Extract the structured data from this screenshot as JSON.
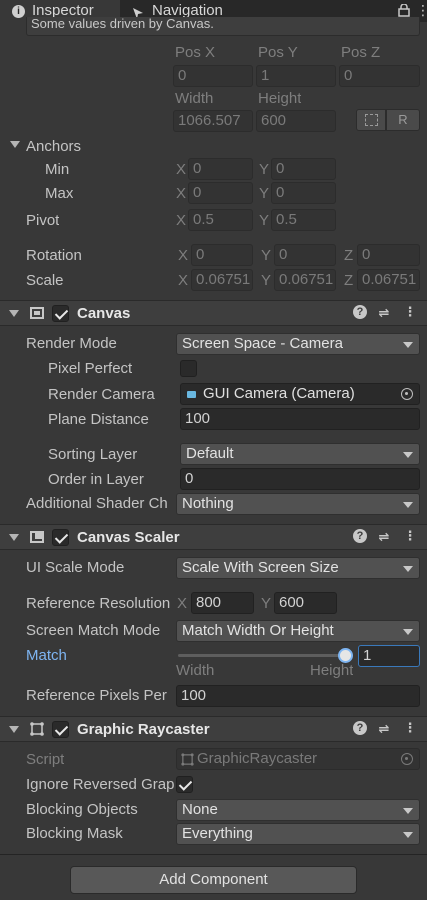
{
  "tabs": {
    "inspector": "Inspector",
    "navigation": "Navigation"
  },
  "rect_transform": {
    "info_text": "Some values driven by Canvas.",
    "pos_x_label": "Pos X",
    "pos_y_label": "Pos Y",
    "pos_z_label": "Pos Z",
    "pos_x": "0",
    "pos_y": "1",
    "pos_z": "0",
    "width_label": "Width",
    "height_label": "Height",
    "width": "1066.507",
    "height": "600",
    "raw_btn": "R",
    "anchors_label": "Anchors",
    "min_label": "Min",
    "max_label": "Max",
    "x": "X",
    "y": "Y",
    "z": "Z",
    "min_x": "0",
    "min_y": "0",
    "max_x": "0",
    "max_y": "0",
    "pivot_label": "Pivot",
    "pivot_x": "0.5",
    "pivot_y": "0.5",
    "rotation_label": "Rotation",
    "rot_x": "0",
    "rot_y": "0",
    "rot_z": "0",
    "scale_label": "Scale",
    "scale_x": "0.06751",
    "scale_y": "0.06751",
    "scale_z": "0.06751"
  },
  "canvas": {
    "title": "Canvas",
    "render_mode_label": "Render Mode",
    "render_mode": "Screen Space - Camera",
    "pixel_perfect_label": "Pixel Perfect",
    "render_camera_label": "Render Camera",
    "render_camera": "GUI Camera (Camera)",
    "plane_distance_label": "Plane Distance",
    "plane_distance": "100",
    "sorting_layer_label": "Sorting Layer",
    "sorting_layer": "Default",
    "order_in_layer_label": "Order in Layer",
    "order_in_layer": "0",
    "shader_channels_label": "Additional Shader Ch",
    "shader_channels": "Nothing"
  },
  "canvas_scaler": {
    "title": "Canvas Scaler",
    "ui_scale_mode_label": "UI Scale Mode",
    "ui_scale_mode": "Scale With Screen Size",
    "ref_res_label": "Reference Resolution",
    "ref_res_x": "800",
    "ref_res_y": "600",
    "screen_match_label": "Screen Match Mode",
    "screen_match": "Match Width Or Height",
    "match_label": "Match",
    "match_value": "1",
    "match_fraction": 1,
    "width_hint": "Width",
    "height_hint": "Height",
    "ref_ppu_label": "Reference Pixels Per",
    "ref_ppu": "100"
  },
  "graphic_raycaster": {
    "title": "Graphic Raycaster",
    "script_label": "Script",
    "script": "GraphicRaycaster",
    "ignore_reversed_label": "Ignore Reversed Grap",
    "blocking_objects_label": "Blocking Objects",
    "blocking_objects": "None",
    "blocking_mask_label": "Blocking Mask",
    "blocking_mask": "Everything"
  },
  "add_component": "Add Component",
  "colors": {
    "accent_blue": "#7eb5f2",
    "panel_bg": "#383838"
  }
}
